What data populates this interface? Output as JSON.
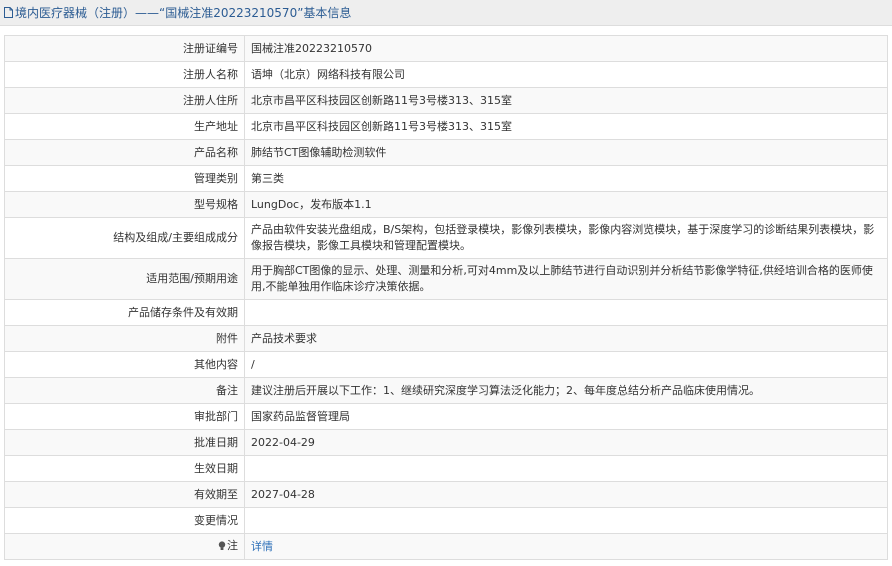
{
  "header": {
    "title": "境内医疗器械（注册）——“国械注准20223210570”基本信息"
  },
  "rows": [
    {
      "label": "注册证编号",
      "value": "国械注准20223210570"
    },
    {
      "label": "注册人名称",
      "value": "语坤（北京）网络科技有限公司"
    },
    {
      "label": "注册人住所",
      "value": "北京市昌平区科技园区创新路11号3号楼313、315室"
    },
    {
      "label": "生产地址",
      "value": "北京市昌平区科技园区创新路11号3号楼313、315室"
    },
    {
      "label": "产品名称",
      "value": "肺结节CT图像辅助检测软件"
    },
    {
      "label": "管理类别",
      "value": "第三类"
    },
    {
      "label": "型号规格",
      "value": "LungDoc，发布版本1.1"
    },
    {
      "label": "结构及组成/主要组成成分",
      "value": "产品由软件安装光盘组成，B/S架构，包括登录模块，影像列表模块，影像内容浏览模块，基于深度学习的诊断结果列表模块，影像报告模块，影像工具模块和管理配置模块。"
    },
    {
      "label": "适用范围/预期用途",
      "value": "用于胸部CT图像的显示、处理、测量和分析,可对4mm及以上肺结节进行自动识别并分析结节影像学特征,供经培训合格的医师使用,不能单独用作临床诊疗决策依据。"
    },
    {
      "label": "产品储存条件及有效期",
      "value": ""
    },
    {
      "label": "附件",
      "value": "产品技术要求"
    },
    {
      "label": "其他内容",
      "value": "/"
    },
    {
      "label": "备注",
      "value": "建议注册后开展以下工作：1、继续研究深度学习算法泛化能力；2、每年度总结分析产品临床使用情况。"
    },
    {
      "label": "审批部门",
      "value": "国家药品监督管理局"
    },
    {
      "label": "批准日期",
      "value": "2022-04-29"
    },
    {
      "label": "生效日期",
      "value": ""
    },
    {
      "label": "有效期至",
      "value": "2027-04-28"
    },
    {
      "label": "变更情况",
      "value": ""
    }
  ],
  "note": {
    "label": "注",
    "icon": "lightbulb-icon",
    "link_label": "详情"
  },
  "colors": {
    "title": "#2c5c93",
    "link": "#2c6fb8",
    "border": "#dddddd",
    "row_alt": "#f9f9f9"
  }
}
